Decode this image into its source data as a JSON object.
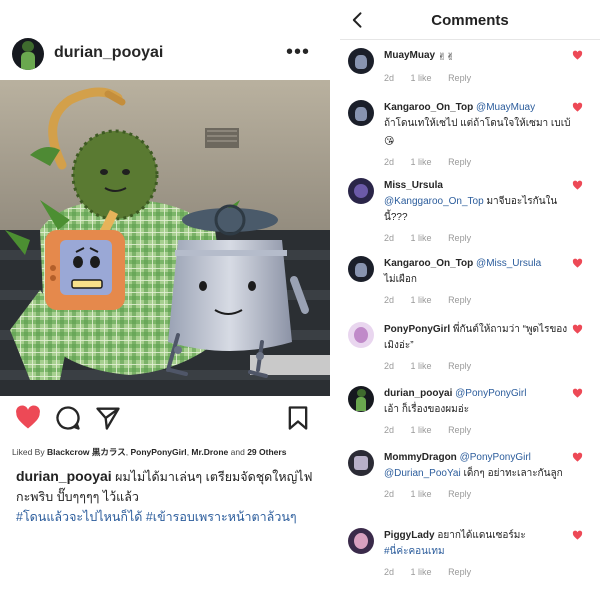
{
  "post": {
    "username": "durian_pooyai",
    "more_icon": "more-horizontal-icon",
    "liked_by_prefix": "Liked By",
    "liked_by_users": [
      "Blackcrow",
      "黒カラス",
      "PonyPonyGirl",
      "Mr.Drone"
    ],
    "liked_by_and": "and",
    "liked_by_others": "29 Others",
    "caption_user": "durian_pooyai",
    "caption_text": "ผมไม่ได้มาเล่นๆ เตรียมจัดชุดใหญ่ไฟกะพริบ ปั๊บๆๆๆๆ ไว้แล้ว",
    "caption_tags": "#โดนแล้วจะไปไหนก็ได้ #เข้ารอบเพราะหน้าตาล้วนๆ",
    "actions": [
      "heart-filled-icon",
      "comment-bubble-icon",
      "share-paper-plane-icon",
      "bookmark-icon"
    ],
    "colors": {
      "like_red": "#ed4956",
      "hashtag_blue": "#2c5d9c"
    }
  },
  "comments_panel": {
    "title": "Comments",
    "back_icon": "chevron-left-icon",
    "heart_color": "#ed4956",
    "comments": [
      {
        "user": "MuayMuay",
        "mention": "",
        "text": "",
        "tag": "",
        "emoji": "✌✌",
        "time": "2d",
        "likes": "1 like",
        "reply": "Reply"
      },
      {
        "user": "Kangaroo_On_Top",
        "mention": "@MuayMuay",
        "text": "ถ้าโดนเทให้เซไป แต่ถ้าโดนใจให้เซมา เบเบ้",
        "tag": "",
        "emoji": "😘",
        "time": "2d",
        "likes": "1 like",
        "reply": "Reply"
      },
      {
        "user": "Miss_Ursula",
        "mention": "@Kanggaroo_On_Top",
        "text": "มาจีบอะไรกันในนี้???",
        "tag": "",
        "emoji": "",
        "time": "2d",
        "likes": "1 like",
        "reply": "Reply"
      },
      {
        "user": "Kangaroo_On_Top",
        "mention": "@Miss_Ursula",
        "text": "ไม่เผือก",
        "tag": "",
        "emoji": "",
        "time": "2d",
        "likes": "1 like",
        "reply": "Reply"
      },
      {
        "user": "PonyPonyGirl",
        "mention": "",
        "text": "พี่กันต์ให้ถามว่า “พูดไรของเมิงอ่ะ”",
        "tag": "",
        "emoji": "",
        "time": "2d",
        "likes": "1 like",
        "reply": "Reply"
      },
      {
        "user": "durian_pooyai",
        "mention": "@PonyPonyGirl",
        "text": "เอ้า ก็เรื่องของผมอ่ะ",
        "tag": "",
        "emoji": "",
        "time": "2d",
        "likes": "1 like",
        "reply": "Reply"
      },
      {
        "user": "MommyDragon",
        "mention": "@PonyPonyGirl @Durian_PooYai",
        "text": "เด็กๆ อย่าทะเลาะกันลูก",
        "tag": "",
        "emoji": "",
        "time": "2d",
        "likes": "1 like",
        "reply": "Reply"
      },
      {
        "user": "PiggyLady",
        "mention": "",
        "text": "อยากได้แดนเซอร์มะ",
        "tag": "#นี่ค่ะคอนเทม",
        "emoji": "",
        "time": "2d",
        "likes": "1 like",
        "reply": "Reply"
      }
    ]
  }
}
